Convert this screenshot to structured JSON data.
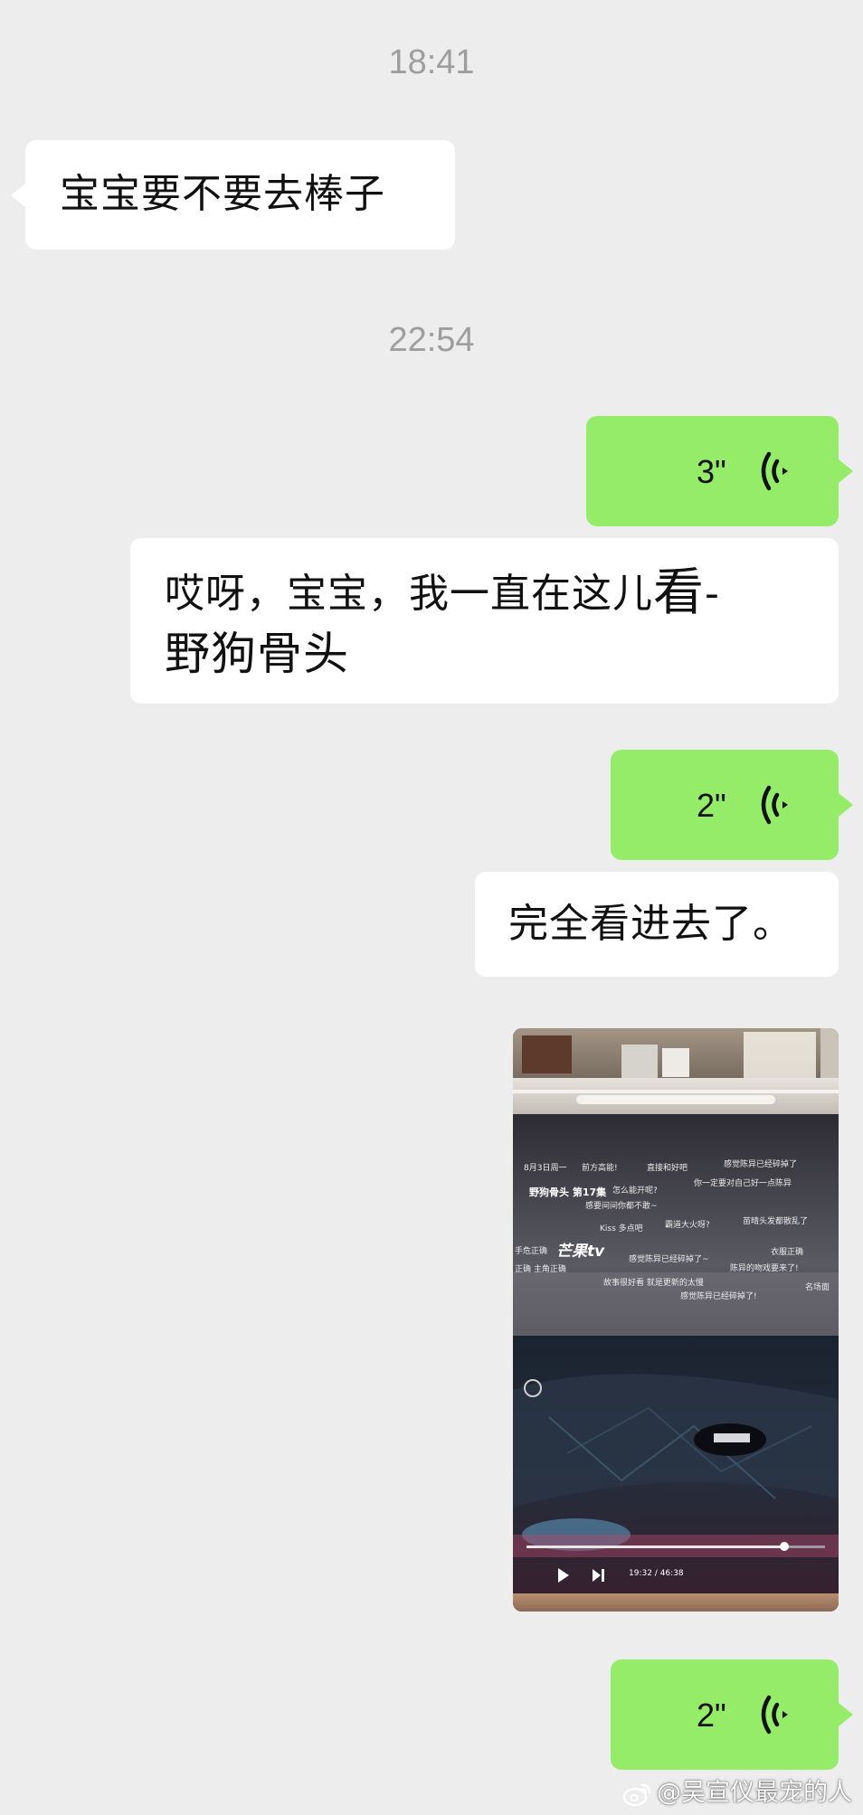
{
  "chat": {
    "timestamps": [
      "18:41",
      "22:54"
    ],
    "messages": [
      {
        "side": "left",
        "type": "text",
        "text": "宝宝要不要去棒子"
      },
      {
        "side": "right",
        "type": "voice",
        "duration": "3\""
      },
      {
        "side": "right",
        "type": "text",
        "line1_start": "哎呀，宝宝，我一直在这儿",
        "line1_big": "看",
        "line1_end": "-",
        "line2": "野狗骨头"
      },
      {
        "side": "right",
        "type": "voice",
        "duration": "2\""
      },
      {
        "side": "right",
        "type": "text",
        "text": "完全看进去了。"
      },
      {
        "side": "right",
        "type": "image",
        "screen": {
          "date": "8月3日周一",
          "show_title": "野狗骨头 第17集",
          "logo": "芒果tv",
          "time_current": "19:32",
          "time_total": "46:38",
          "danmaku": [
            "前方高能!",
            "直接和好吧",
            "感觉陈异已经碎掉了",
            "你一定要对自己好一点陈异",
            "感要间间你都不敢~",
            "怎么能开呢?",
            "Kiss 多点吧",
            "霸道大火呀?",
            "苗晴头发都散乱了",
            "手危正确",
            "正确 主角正确",
            "感觉陈异已经碎掉了~",
            "衣服正确",
            "陈异的吻戏要来了!",
            "故事很好看 就是更新的太慢",
            "名场面",
            "感觉陈异已经碎掉了!"
          ]
        }
      },
      {
        "side": "right",
        "type": "voice",
        "duration": "2\""
      }
    ]
  },
  "watermark": "@吴宣仪最宠的人",
  "colors": {
    "background": "#ededed",
    "bubble_self": "#95ec69",
    "bubble_other": "#ffffff",
    "timestamp": "#9e9e9e"
  }
}
